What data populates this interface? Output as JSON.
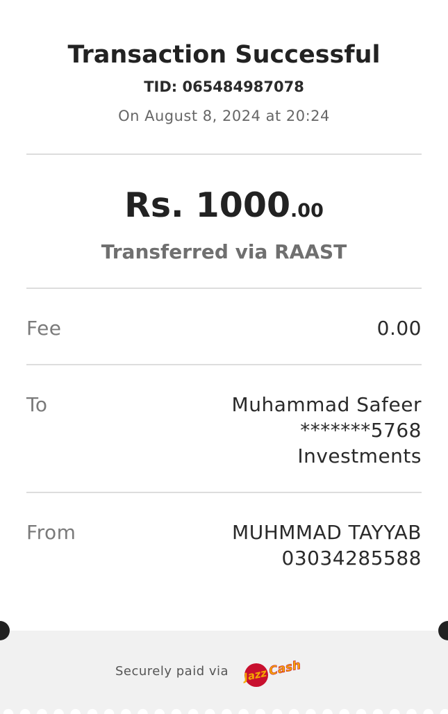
{
  "header": {
    "title": "Transaction Successful",
    "tid": "TID: 065484987078",
    "date": "On August 8, 2024 at 20:24"
  },
  "amount": {
    "main": "Rs. 1000",
    "decimals": ".00",
    "via": "Transferred via RAAST"
  },
  "details": {
    "fee": {
      "label": "Fee",
      "value": "0.00"
    },
    "to": {
      "label": "To",
      "name": "Muhammad Safeer",
      "account": "*******5768",
      "bank": "Investments"
    },
    "from": {
      "label": "From",
      "name": "MUHMMAD TAYYAB",
      "account": "03034285588"
    }
  },
  "footer": {
    "secure_text": "Securely paid via",
    "logo": {
      "icon": "jazzcash-logo",
      "text_left": "Jazz",
      "text_right": "Cash",
      "colors": {
        "red": "#c8102e",
        "yellow": "#f5a800"
      }
    },
    "background": "#f1f1f1"
  }
}
